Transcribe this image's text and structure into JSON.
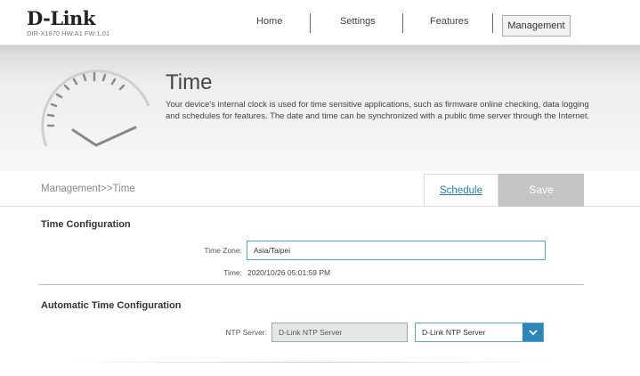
{
  "header": {
    "logo": "D-Link",
    "model": "DIR-X1870 HW:A1 FW:1.01",
    "nav": [
      {
        "label": "Home"
      },
      {
        "label": "Settings"
      },
      {
        "label": "Features"
      },
      {
        "label": "Management"
      }
    ]
  },
  "banner": {
    "title": "Time",
    "description": "Your device's internal clock is used for time sensitive applications, such as firmware online checking, data logging and schedules for features. The date and time can be synchronized with a public time server through the Internet."
  },
  "toolbar": {
    "breadcrumb": "Management>>Time",
    "schedule_label": "Schedule",
    "save_label": "Save"
  },
  "time_config": {
    "title": "Time Configuration",
    "time_zone_label": "Time Zone:",
    "time_zone_value": "Asia/Taipei",
    "time_label": "Time:",
    "time_value": "2020/10/26 05:01:59 PM"
  },
  "auto_time": {
    "title": "Automatic Time Configuration",
    "ntp_label": "NTP Server:",
    "ntp_value": "D-Link NTP Server",
    "ntp_select_value": "D-Link NTP Server"
  },
  "colors": {
    "accent": "#2e86b8",
    "save_disabled": "#c4c4c4"
  }
}
